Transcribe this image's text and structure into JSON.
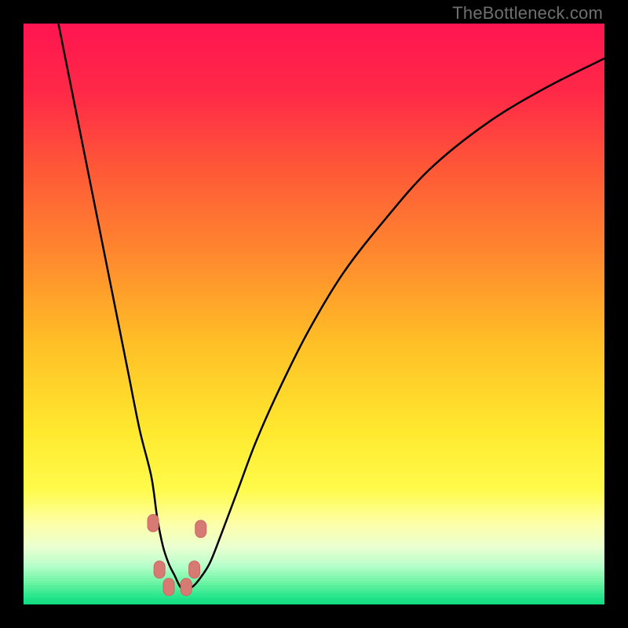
{
  "watermark": "TheBottleneck.com",
  "colors": {
    "black": "#000000",
    "watermark_gray": "#6f6f6f",
    "curve": "#000000",
    "marker_fill": "#d87a74",
    "marker_stroke": "#c96a62",
    "gradient_stops": [
      {
        "pos": 0.0,
        "color": "#ff1550"
      },
      {
        "pos": 0.12,
        "color": "#ff2a47"
      },
      {
        "pos": 0.25,
        "color": "#ff5937"
      },
      {
        "pos": 0.4,
        "color": "#ff8a2e"
      },
      {
        "pos": 0.55,
        "color": "#ffc026"
      },
      {
        "pos": 0.7,
        "color": "#ffe92f"
      },
      {
        "pos": 0.8,
        "color": "#fffb4a"
      },
      {
        "pos": 0.86,
        "color": "#fdffab"
      },
      {
        "pos": 0.9,
        "color": "#e9ffd1"
      },
      {
        "pos": 0.93,
        "color": "#baffcb"
      },
      {
        "pos": 0.96,
        "color": "#6cf4a4"
      },
      {
        "pos": 0.985,
        "color": "#26e58c"
      },
      {
        "pos": 1.0,
        "color": "#0ad97c"
      }
    ]
  },
  "chart_data": {
    "type": "line",
    "title": "",
    "xlabel": "",
    "ylabel": "",
    "xlim": [
      0,
      100
    ],
    "ylim": [
      0,
      100
    ],
    "grid": false,
    "legend": false,
    "series": [
      {
        "name": "bottleneck-curve",
        "x": [
          6,
          8,
          10,
          12,
          14,
          16,
          18,
          20,
          22,
          23,
          24,
          25,
          26,
          27,
          28,
          29,
          30,
          32,
          34,
          37,
          40,
          44,
          49,
          55,
          62,
          70,
          80,
          90,
          100
        ],
        "y": [
          100,
          90,
          80,
          70,
          60,
          50,
          40,
          30,
          22,
          15,
          10,
          7,
          5,
          3,
          2.5,
          3,
          4,
          7,
          12,
          20,
          28,
          37,
          47,
          57,
          66,
          75,
          83,
          89,
          94
        ]
      }
    ],
    "markers": [
      {
        "name": "marker-left-upper",
        "x": 22.3,
        "y": 14
      },
      {
        "name": "marker-left-lower",
        "x": 23.4,
        "y": 6
      },
      {
        "name": "marker-trough-left",
        "x": 25.0,
        "y": 3
      },
      {
        "name": "marker-trough-right",
        "x": 28.0,
        "y": 3
      },
      {
        "name": "marker-right-lower",
        "x": 29.4,
        "y": 6
      },
      {
        "name": "marker-right-upper",
        "x": 30.5,
        "y": 13
      }
    ]
  }
}
